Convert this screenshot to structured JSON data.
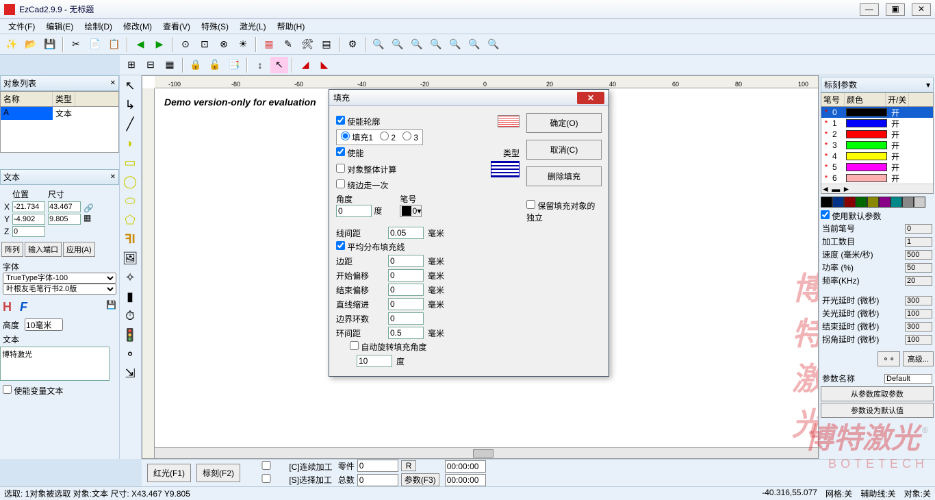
{
  "title": "EzCad2.9.9 - 无标题",
  "menu": [
    "文件(F)",
    "编辑(E)",
    "绘制(D)",
    "修改(M)",
    "查看(V)",
    "特殊(S)",
    "激光(L)",
    "帮助(H)"
  ],
  "objlist": {
    "title": "对象列表",
    "cols": [
      "名称",
      "类型"
    ],
    "row": {
      "name": "A",
      "type": "文本"
    }
  },
  "textpanel": {
    "title": "文本",
    "pos_label": "位置",
    "size_label": "尺寸",
    "x": "-21.734",
    "y": "-4.902",
    "z": "0",
    "w": "43.467",
    "h": "9.805",
    "array": "阵列",
    "ioport": "输入端口",
    "apply": "应用(A)",
    "font_label": "字体",
    "font_type": "TrueType字体-100",
    "font_name": "叶根友毛笔行书2.0版",
    "height_label": "高度",
    "height": "10毫米",
    "text_label": "文本",
    "text": "博特激光",
    "var_text": "使能变量文本"
  },
  "canvas": {
    "demo": "Demo version-only for evaluation"
  },
  "watermark": {
    "main": "博特激光",
    "sub": "BOTETECH",
    "reg": "®"
  },
  "rulerTicks": [
    "-100",
    "-80",
    "-60",
    "-40",
    "-20",
    "0",
    "20",
    "40",
    "60",
    "80",
    "100"
  ],
  "rightpanel": {
    "title": "标刻参数",
    "cols": [
      "笔号",
      "颜色",
      "开/关"
    ],
    "pens": [
      {
        "n": "0",
        "c": "#000000",
        "on": "开",
        "sel": true
      },
      {
        "n": "1",
        "c": "#0000ff",
        "on": "开"
      },
      {
        "n": "2",
        "c": "#ff0000",
        "on": "开"
      },
      {
        "n": "3",
        "c": "#00ff00",
        "on": "开"
      },
      {
        "n": "4",
        "c": "#ffff00",
        "on": "开"
      },
      {
        "n": "5",
        "c": "#ff00ff",
        "on": "开"
      },
      {
        "n": "6",
        "c": "#ffb0b0",
        "on": "开"
      }
    ],
    "colors": [
      "#000",
      "#038",
      "#800",
      "#060",
      "#880",
      "#808",
      "#088",
      "#888",
      "#ccc",
      "#00f",
      "#f00",
      "#0f0",
      "#ff0",
      "#f0f",
      "#0ff",
      "#fff",
      "#fa8",
      "#f55"
    ],
    "use_default": "使用默认参数",
    "params": [
      {
        "l": "当前笔号",
        "v": "0"
      },
      {
        "l": "加工数目",
        "v": "1"
      },
      {
        "l": "速度 (毫米/秒)",
        "v": "500"
      },
      {
        "l": "功率 (%)",
        "v": "50"
      },
      {
        "l": "频率(KHz)",
        "v": "20"
      }
    ],
    "params2": [
      {
        "l": "开光延时 (微秒)",
        "v": "300"
      },
      {
        "l": "关光延时 (微秒)",
        "v": "100"
      },
      {
        "l": "结束延时 (微秒)",
        "v": "300"
      },
      {
        "l": "拐角延时 (微秒)",
        "v": "100"
      }
    ],
    "advanced": "高级...",
    "param_name_l": "参数名称",
    "param_name": "Default",
    "load_param": "从参数库取参数",
    "save_param": "参数设为默认值"
  },
  "bottom": {
    "red": "红光(F1)",
    "mark": "标刻(F2)",
    "cont": "[C]连续加工",
    "sel": "[S]选择加工",
    "parts": "零件",
    "parts_v": "0",
    "r": "R",
    "total": "总数",
    "total_v": "0",
    "t1": "00:00:00",
    "t2": "00:00:00",
    "param": "参数(F3)"
  },
  "status": {
    "left": "选取: 1对象被选取 对象:文本 尺寸: X43.467 Y9.805",
    "coord": "-40.316,55.077",
    "grid": "网格:关",
    "snap": "辅助线:关",
    "obj": "对象:关"
  },
  "dialog": {
    "title": "填充",
    "ok": "确定(O)",
    "cancel": "取消(C)",
    "delfill": "删除填充",
    "enable_outline": "使能轮廓",
    "fill1": "填充1",
    "enable": "使能",
    "type": "类型",
    "whole": "对象整体计算",
    "around": "绕边走一次",
    "angle_l": "角度",
    "angle": "0",
    "deg": "度",
    "pen_l": "笔号",
    "pen": "0",
    "keep_indep": "保留填充对象的独立",
    "linespace_l": "线间距",
    "linespace": "0.05",
    "mm": "毫米",
    "avg": "平均分布填充线",
    "margin_l": "边距",
    "margin": "0",
    "startoff_l": "开始偏移",
    "startoff": "0",
    "endoff_l": "结束偏移",
    "endoff": "0",
    "shrink_l": "直线缩进",
    "shrink": "0",
    "rings_l": "边界环数",
    "rings": "0",
    "ringspace_l": "环间距",
    "ringspace": "0.5",
    "autorotate": "自动旋转填充角度",
    "autorotate_v": "10"
  }
}
